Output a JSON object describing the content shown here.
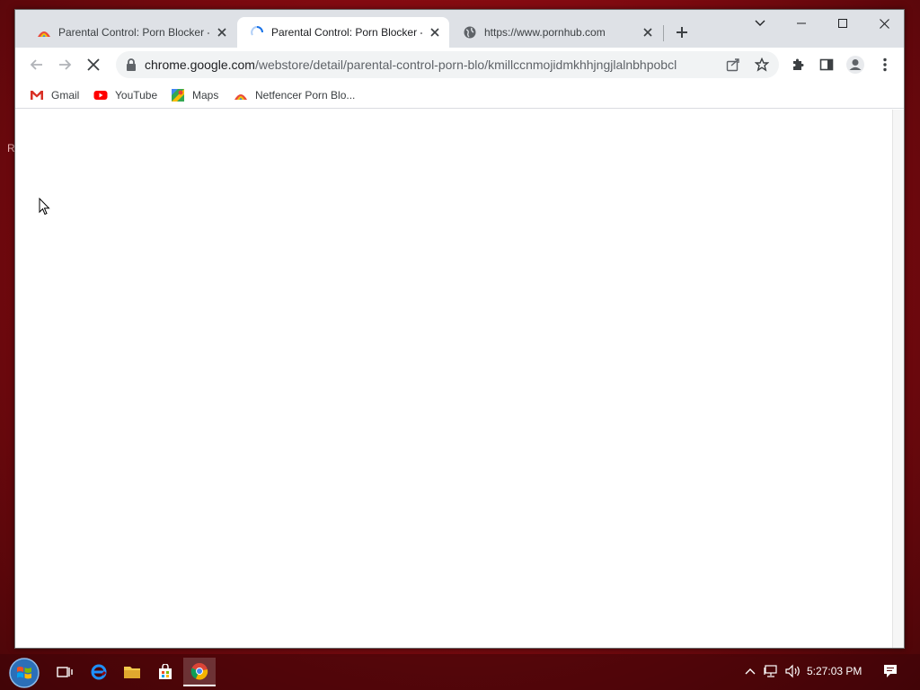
{
  "desktop": {
    "edge_letter": "R"
  },
  "tabs": [
    {
      "title": "Parental Control: Porn Blocker - ",
      "favicon": "netfencer-favicon",
      "active": false
    },
    {
      "title": "Parental Control: Porn Blocker - ",
      "favicon": "loading-spinner-icon",
      "active": true
    },
    {
      "title": "https://www.pornhub.com",
      "favicon": "globe-icon",
      "active": false
    }
  ],
  "toolbar": {
    "url_host": "chrome.google.com",
    "url_path": "/webstore/detail/parental-control-porn-blo/kmillccnmojidmkhhjngjlalnbhpobcl"
  },
  "bookmarks": [
    {
      "label": "Gmail",
      "icon": "gmail-icon"
    },
    {
      "label": "YouTube",
      "icon": "youtube-icon"
    },
    {
      "label": "Maps",
      "icon": "maps-icon"
    },
    {
      "label": "Netfencer Porn Blo...",
      "icon": "netfencer-icon"
    }
  ],
  "taskbar": {
    "clock": "5:27:03 PM"
  },
  "colors": {
    "accent_blue": "#1a73e8",
    "chrome_frame": "#dee1e6",
    "desktop_red": "#9a0e14"
  }
}
